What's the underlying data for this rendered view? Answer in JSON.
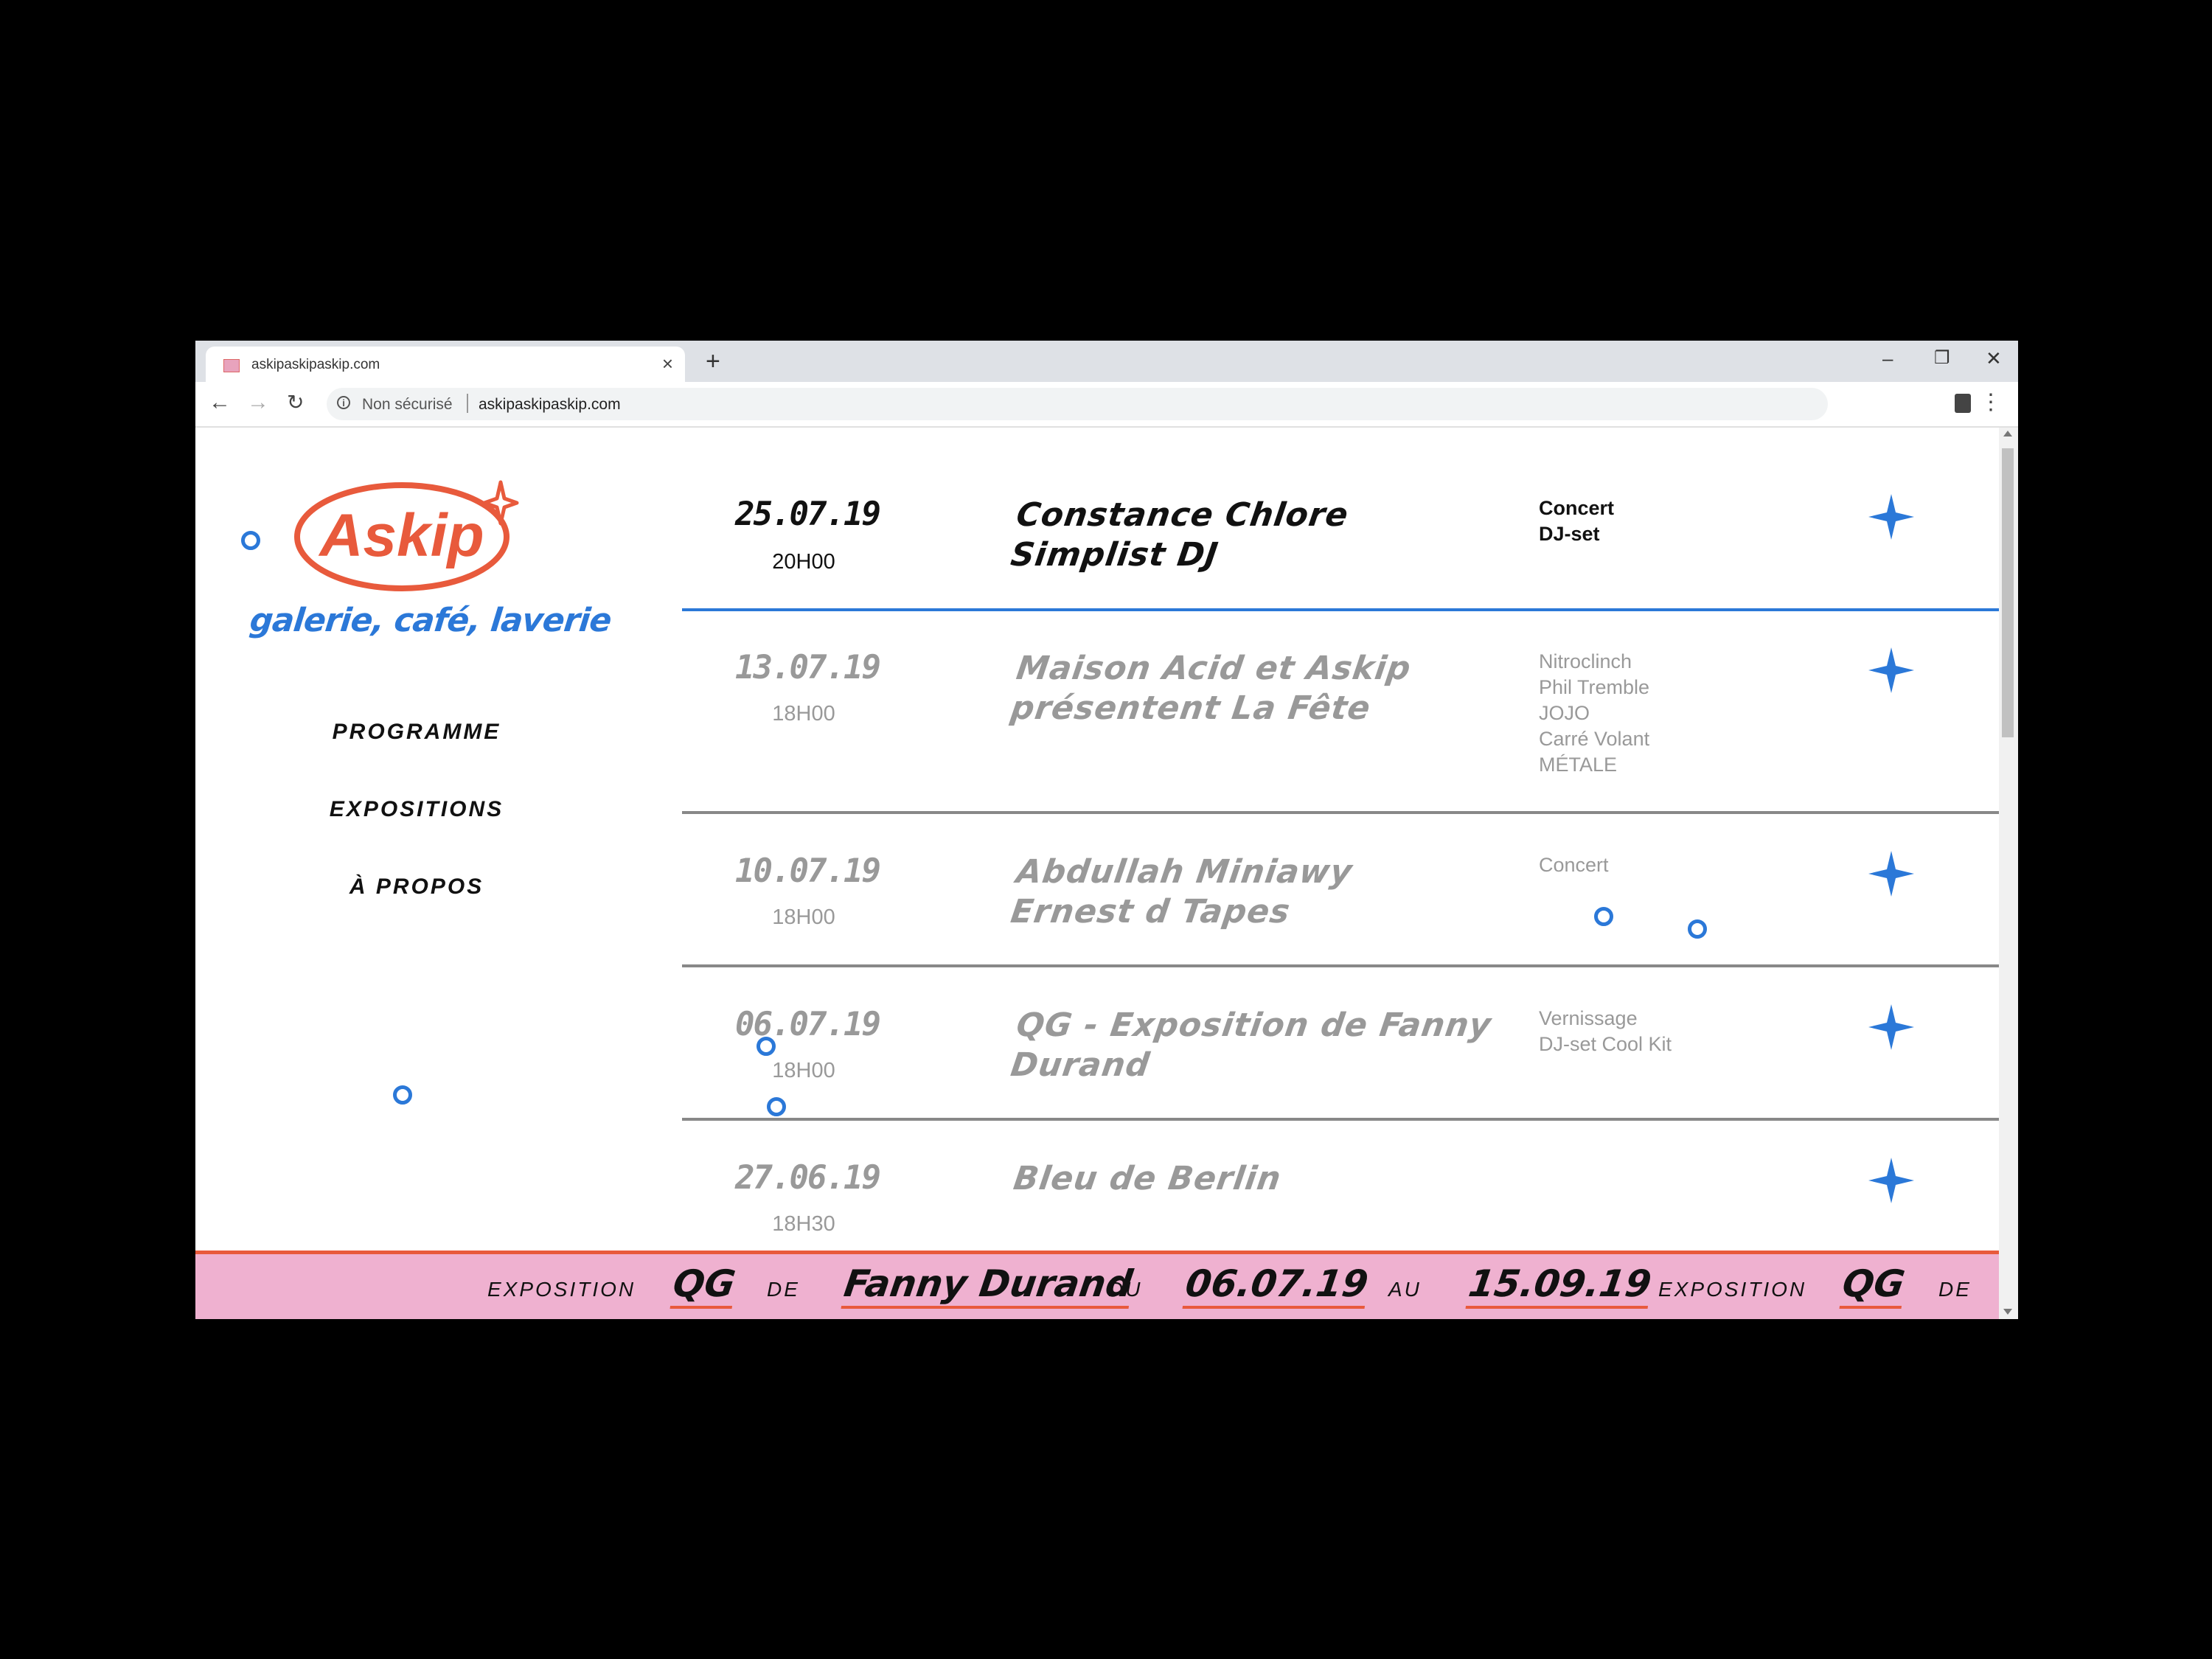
{
  "browser": {
    "tab_title": "askipaskipaskip.com",
    "security_label": "Non sécurisé",
    "url": "askipaskipaskip.com"
  },
  "site": {
    "logo_text": "Askip",
    "tagline": "galerie, café, laverie",
    "nav": [
      "PROGRAMME",
      "EXPOSITIONS",
      "À PROPOS"
    ],
    "accent_color": "#2b78d8",
    "brand_color": "#e85a3c",
    "ticker_bg": "#efb1d0"
  },
  "events": [
    {
      "date": "25.07.19",
      "time": "20H00",
      "title": [
        "Constance Chlore",
        "Simplist DJ"
      ],
      "tags": [
        "Concert",
        "DJ-set"
      ],
      "active": true
    },
    {
      "date": "13.07.19",
      "time": "18H00",
      "title": [
        "Maison Acid et Askip",
        "présentent La Fête"
      ],
      "tags": [
        "Nitroclinch",
        "Phil Tremble",
        "JOJO",
        "Carré Volant",
        "MÉTALE"
      ],
      "active": false
    },
    {
      "date": "10.07.19",
      "time": "18H00",
      "title": [
        "Abdullah Miniawy",
        "Ernest d Tapes"
      ],
      "tags": [
        "Concert"
      ],
      "active": false
    },
    {
      "date": "06.07.19",
      "time": "18H00",
      "title": [
        "QG - Exposition de Fanny",
        "Durand"
      ],
      "tags": [
        "Vernissage",
        "DJ-set Cool Kit"
      ],
      "active": false
    },
    {
      "date": "27.06.19",
      "time": "18H30",
      "title": [
        "Bleu de Berlin"
      ],
      "tags": [],
      "active": false
    }
  ],
  "ticker": {
    "items": [
      "EXPOSITION",
      "QG",
      "DE",
      "Fanny Durand",
      "DU",
      "06.07.19",
      "AU",
      "15.09.19",
      "EXPOSITION",
      "QG",
      "DE"
    ]
  }
}
